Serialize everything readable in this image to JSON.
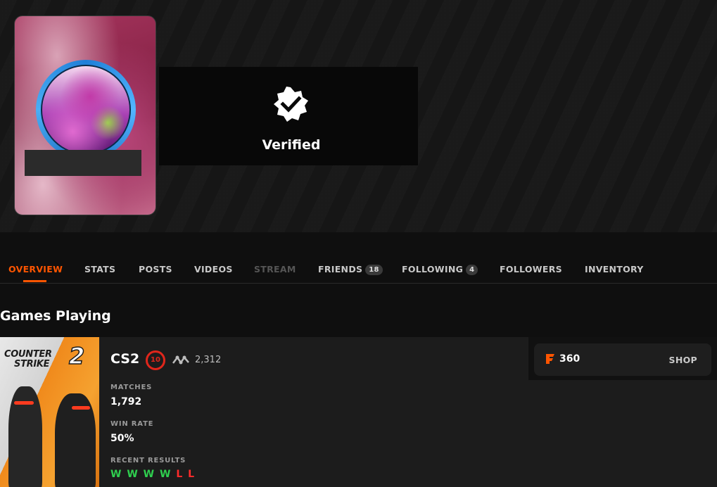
{
  "header": {
    "verified_label": "Verified"
  },
  "tabs": {
    "overview": "OVERVIEW",
    "stats": "STATS",
    "posts": "POSTS",
    "videos": "VIDEOS",
    "stream": "STREAM",
    "friends": "FRIENDS",
    "friends_count": "18",
    "following": "FOLLOWING",
    "following_count": "4",
    "followers": "FOLLOWERS",
    "inventory": "INVENTORY"
  },
  "games": {
    "section_title": "Games Playing",
    "art_title_line1": "COUNTER",
    "art_title_line2": "STRIKE",
    "art_title_number": "2",
    "name": "CS2",
    "level": "10",
    "elo": "2,312",
    "matches_label": "MATCHES",
    "matches_value": "1,792",
    "win_rate_label": "WIN RATE",
    "win_rate_value": "50%",
    "recent_label": "RECENT RESULTS",
    "recent_results": [
      "W",
      "W",
      "W",
      "W",
      "L",
      "L"
    ]
  },
  "shop": {
    "points": "360",
    "label": "SHOP"
  },
  "colors": {
    "accent": "#ff5500",
    "win": "#2fcf4f",
    "loss": "#ff2b2b",
    "level_badge": "#e0261b"
  },
  "icons": {
    "verified": "verified-badge-icon",
    "elo": "elo-trend-icon",
    "currency": "faceit-points-icon"
  }
}
